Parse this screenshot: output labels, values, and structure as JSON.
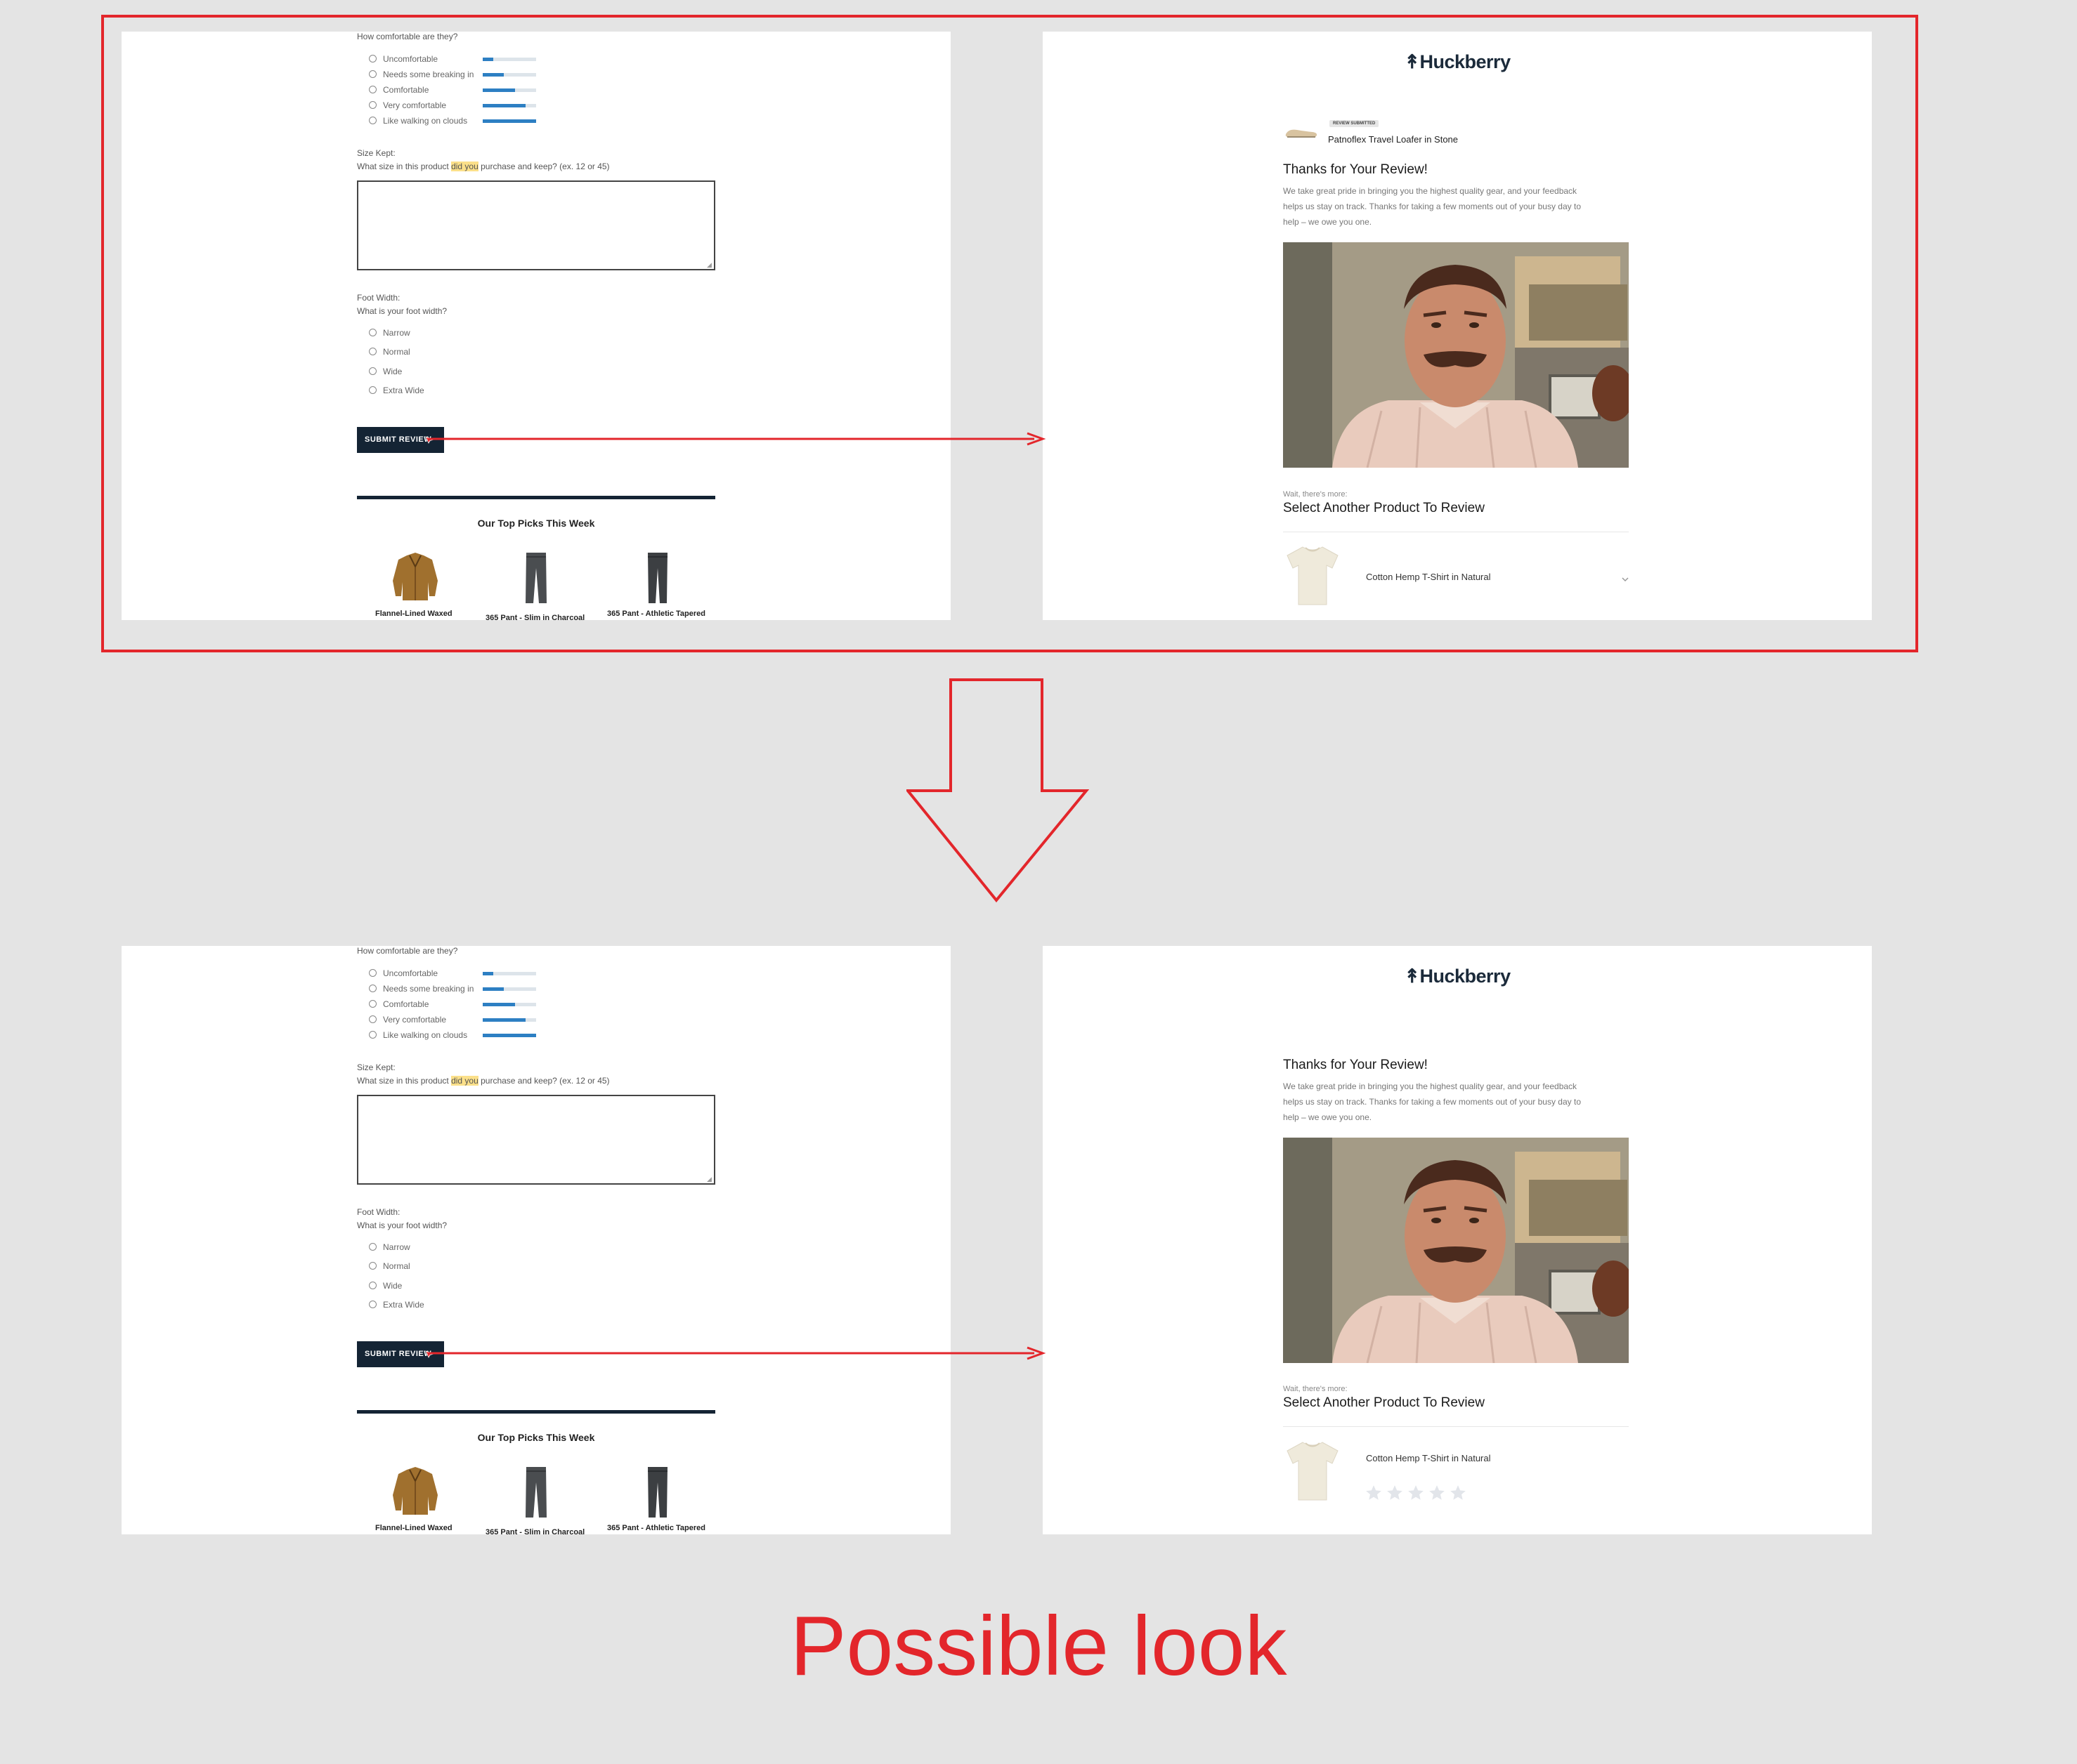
{
  "form": {
    "comfort_question": "How comfortable are they?",
    "comfort_options": [
      {
        "label": "Uncomfortable",
        "level": 0.2
      },
      {
        "label": "Needs some breaking in",
        "level": 0.4
      },
      {
        "label": "Comfortable",
        "level": 0.6
      },
      {
        "label": "Very comfortable",
        "level": 0.8
      },
      {
        "label": "Like walking on clouds",
        "level": 1.0
      }
    ],
    "size_label": "Size Kept:",
    "size_question_before": "What size in this product ",
    "size_question_highlight": "did you",
    "size_question_after": " purchase and keep? (ex. 12 or 45)",
    "width_label": "Foot Width:",
    "width_question": "What is your foot width?",
    "width_options": [
      "Narrow",
      "Normal",
      "Wide",
      "Extra Wide"
    ],
    "submit_label": "SUBMIT REVIEW",
    "picks_title": "Our Top Picks This Week",
    "picks": [
      "Flannel-Lined Waxed",
      "365 Pant - Slim in Charcoal",
      "365 Pant - Athletic Tapered"
    ]
  },
  "confirmation": {
    "logo": "Huckberry",
    "badge": "REVIEW SUBMITTED",
    "product_name": "Patnoflex Travel Loafer in Stone",
    "thanks_title": "Thanks for Your Review!",
    "thanks_lines": [
      "We take great pride in bringing you the highest quality gear, and your feedback",
      "helps us stay on track. Thanks for taking a few moments out of your busy day to",
      "help – we owe you one."
    ],
    "wait_text": "Wait, there's more:",
    "select_title": "Select Another Product To Review",
    "next_product": "Cotton Hemp T-Shirt in Natural",
    "star_count": 5
  },
  "caption": "Possible look",
  "colors": {
    "accent_red": "#e3262b",
    "navy": "#142434",
    "bar_blue": "#2d7fc3",
    "background": "#e4e4e4"
  }
}
